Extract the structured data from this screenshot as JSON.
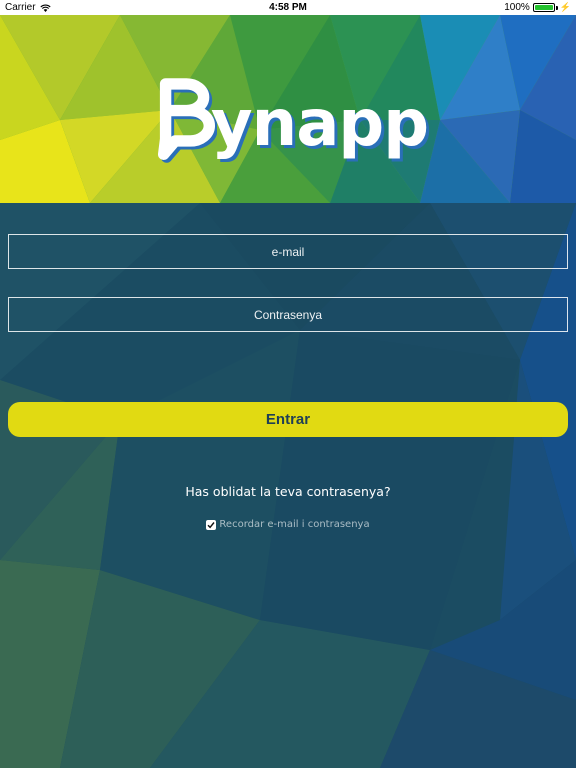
{
  "status_bar": {
    "carrier": "Carrier",
    "time": "4:58 PM",
    "battery": "100%",
    "battery_level": 1.0,
    "icons": [
      "wifi-icon",
      "battery-icon",
      "charging-icon"
    ]
  },
  "header": {
    "logo_text": "ynapp",
    "logo_alt": "Bynapp"
  },
  "form": {
    "email_placeholder": "e-mail",
    "password_placeholder": "Contrasenya",
    "submit_label": "Entrar",
    "forgot_password": "Has oblidat la teva contrasenya?",
    "remember_label": "Recordar e-mail i contrasenya",
    "remember_checked": true
  },
  "colors": {
    "button": "#e1da12",
    "button_text": "#1f3f56",
    "form_background": "#1b4c62",
    "logo_shadow": "#2a6fb8"
  }
}
